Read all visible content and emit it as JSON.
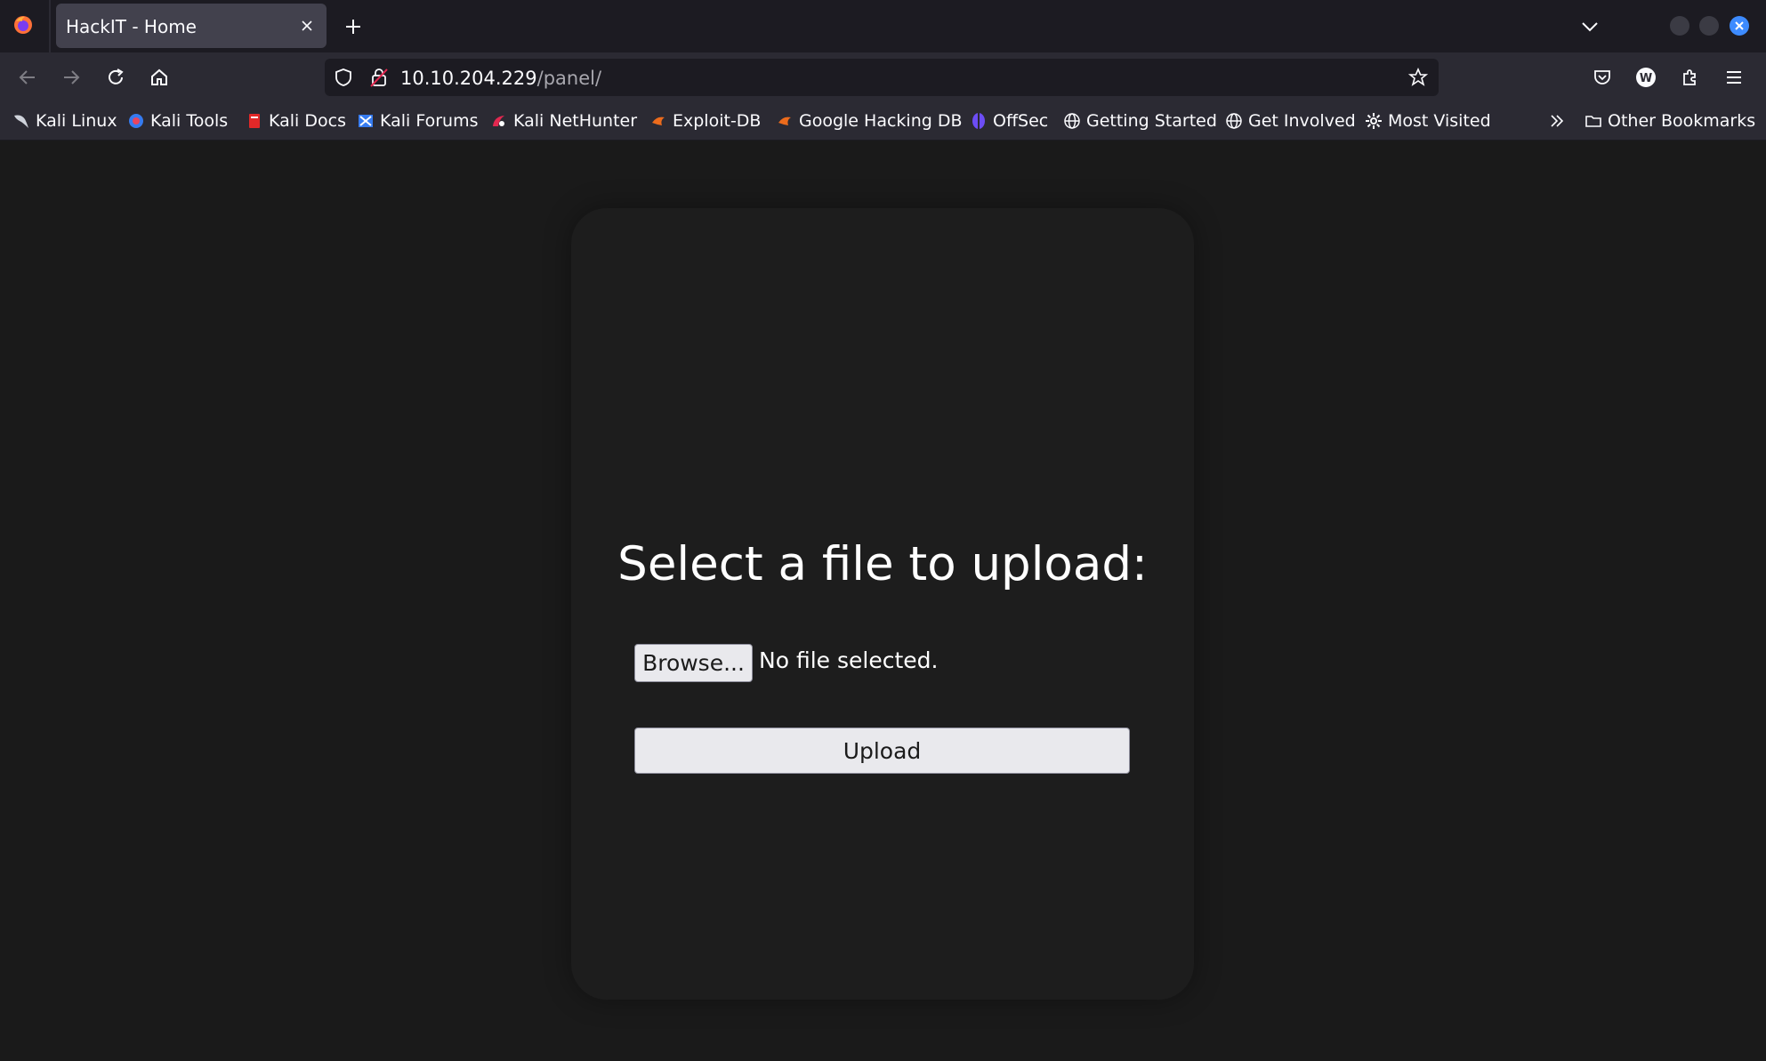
{
  "browser": {
    "tab_title": "HackIT - Home",
    "url_host": "10.10.204.229",
    "url_path": "/panel/",
    "accent_color": "#3d8bff"
  },
  "bookmarks": [
    {
      "label": "Kali Linux",
      "icon": "kali-dragon-icon"
    },
    {
      "label": "Kali Tools",
      "icon": "kali-tools-icon"
    },
    {
      "label": "Kali Docs",
      "icon": "kali-docs-icon"
    },
    {
      "label": "Kali Forums",
      "icon": "kali-forums-icon"
    },
    {
      "label": "Kali NetHunter",
      "icon": "nethunter-icon"
    },
    {
      "label": "Exploit-DB",
      "icon": "exploit-db-icon"
    },
    {
      "label": "Google Hacking DB",
      "icon": "ghdb-icon"
    },
    {
      "label": "OffSec",
      "icon": "offsec-icon"
    },
    {
      "label": "Getting Started",
      "icon": "globe-icon"
    },
    {
      "label": "Get Involved",
      "icon": "globe-icon"
    },
    {
      "label": "Most Visited",
      "icon": "gear-icon"
    }
  ],
  "other_bookmarks": "Other Bookmarks",
  "page": {
    "heading": "Select a file to upload:",
    "browse_label": "Browse...",
    "file_status": "No file selected.",
    "upload_label": "Upload"
  }
}
